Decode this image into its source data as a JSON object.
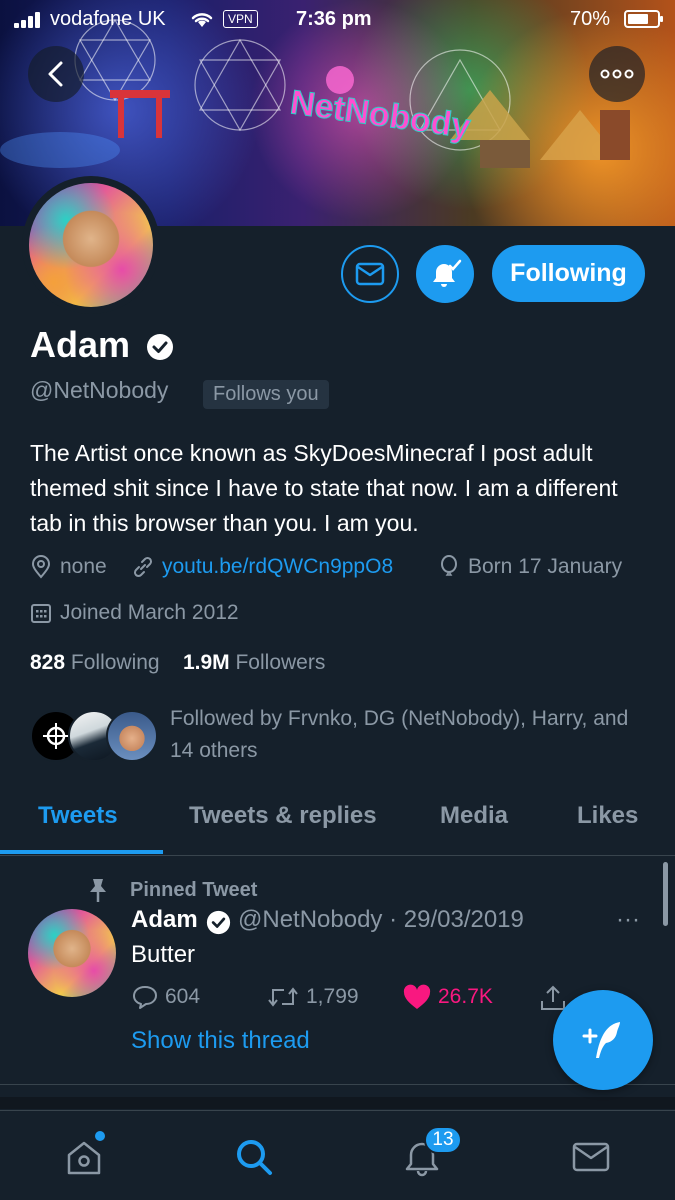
{
  "status_bar": {
    "carrier": "vodafone UK",
    "vpn": "VPN",
    "time": "7:36 pm",
    "battery_percent": "70%",
    "battery_level": 0.7
  },
  "profile": {
    "name": "Adam",
    "handle": "@NetNobody",
    "follows_you": "Follows you",
    "following_button": "Following",
    "bio": "The Artist once known as SkyDoesMinecraf I post adult themed shit since I have to state that now. I am a different tab in this browser than you. I am you.",
    "location": "none",
    "website": "youtu.be/rdQWCn9ppO8",
    "birthday": "Born 17 January",
    "joined": "Joined March 2012",
    "following_count": "828",
    "following_label": "Following",
    "followers_count": "1.9M",
    "followers_label": "Followers",
    "followed_by": "Followed by Frvnko, DG (NetNobody), Harry, and 14 others"
  },
  "tabs": [
    {
      "label": "Tweets",
      "active": true
    },
    {
      "label": "Tweets & replies",
      "active": false
    },
    {
      "label": "Media",
      "active": false
    },
    {
      "label": "Likes",
      "active": false
    }
  ],
  "pinned_tweet": {
    "pinned_label": "Pinned Tweet",
    "name": "Adam",
    "handle_date": "@NetNobody · 29/03/2019",
    "text": "Butter",
    "replies": "604",
    "retweets": "1,799",
    "likes": "26.7K",
    "show_thread": "Show this thread",
    "more": "···"
  },
  "bottom_nav": {
    "notifications_badge": "13"
  },
  "colors": {
    "background": "#15202b",
    "accent": "#1d9bf0",
    "secondary_text": "#8b98a5",
    "like": "#f91880"
  }
}
